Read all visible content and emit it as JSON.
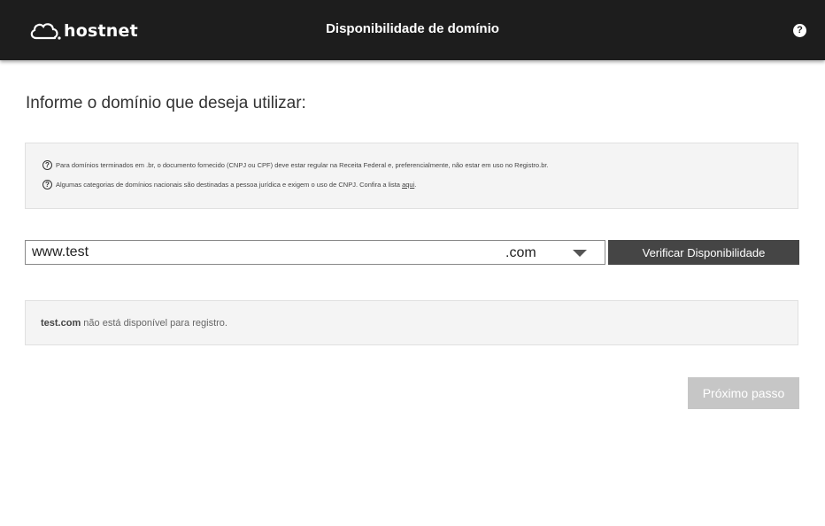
{
  "header": {
    "logo_text": "hostnet",
    "title": "Disponibilidade de domínio",
    "help_icon": "question-circle-icon"
  },
  "main": {
    "prompt": "Informe o domínio que deseja utilizar:",
    "info": {
      "line1": "Para domínios terminados em .br, o documento fornecido (CNPJ ou CPF) deve estar regular na Receita Federal e, preferencialmente, não estar em uso no Registro.br.",
      "line2_text": "Algumas categorias de domínios nacionais são destinadas a pessoa jurídica e exigem o uso de CNPJ. Confira a lista",
      "line2_link": "aqui",
      "line2_end": "."
    },
    "domain_input_value": "www.test",
    "tld_selected": ".com",
    "verify_button": "Verificar Disponibilidade",
    "result": {
      "domain": "test.com",
      "message": " não está disponível para registro."
    },
    "next_button": "Próximo passo"
  },
  "colors": {
    "header_bg": "#1d1d1d",
    "verify_bg": "#454545",
    "next_disabled_bg": "#c6c6c6",
    "box_bg": "#f4f4f4"
  }
}
